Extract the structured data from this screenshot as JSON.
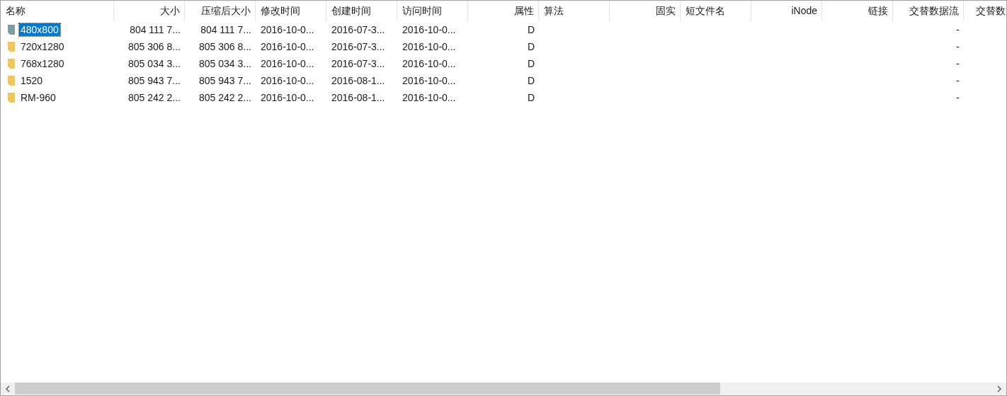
{
  "table": {
    "columns": [
      {
        "label": "名称",
        "kind": "text"
      },
      {
        "label": "大小",
        "kind": "number"
      },
      {
        "label": "压缩后大小",
        "kind": "number"
      },
      {
        "label": "修改时间",
        "kind": "text"
      },
      {
        "label": "创建时间",
        "kind": "text"
      },
      {
        "label": "访问时间",
        "kind": "text"
      },
      {
        "label": "属性",
        "kind": "number"
      },
      {
        "label": "算法",
        "kind": "text"
      },
      {
        "label": "固实",
        "kind": "number"
      },
      {
        "label": "短文件名",
        "kind": "text"
      },
      {
        "label": "iNode",
        "kind": "number"
      },
      {
        "label": "链接",
        "kind": "number"
      },
      {
        "label": "交替数据流",
        "kind": "number"
      },
      {
        "label": "交替数",
        "kind": "number"
      }
    ],
    "rows": [
      {
        "selected": true,
        "cells": [
          "480x800",
          "804 111 7...",
          "804 111 7...",
          "2016-10-0...",
          "2016-07-3...",
          "2016-10-0...",
          "D",
          "",
          "",
          "",
          "",
          "",
          "-",
          ""
        ]
      },
      {
        "selected": false,
        "cells": [
          "720x1280",
          "805 306 8...",
          "805 306 8...",
          "2016-10-0...",
          "2016-07-3...",
          "2016-10-0...",
          "D",
          "",
          "",
          "",
          "",
          "",
          "-",
          ""
        ]
      },
      {
        "selected": false,
        "cells": [
          "768x1280",
          "805 034 3...",
          "805 034 3...",
          "2016-10-0...",
          "2016-07-3...",
          "2016-10-0...",
          "D",
          "",
          "",
          "",
          "",
          "",
          "-",
          ""
        ]
      },
      {
        "selected": false,
        "cells": [
          "1520",
          "805 943 7...",
          "805 943 7...",
          "2016-10-0...",
          "2016-08-1...",
          "2016-10-0...",
          "D",
          "",
          "",
          "",
          "",
          "",
          "-",
          ""
        ]
      },
      {
        "selected": false,
        "cells": [
          "RM-960",
          "805 242 2...",
          "805 242 2...",
          "2016-10-0...",
          "2016-08-1...",
          "2016-10-0...",
          "D",
          "",
          "",
          "",
          "",
          "",
          "-",
          ""
        ]
      }
    ]
  }
}
